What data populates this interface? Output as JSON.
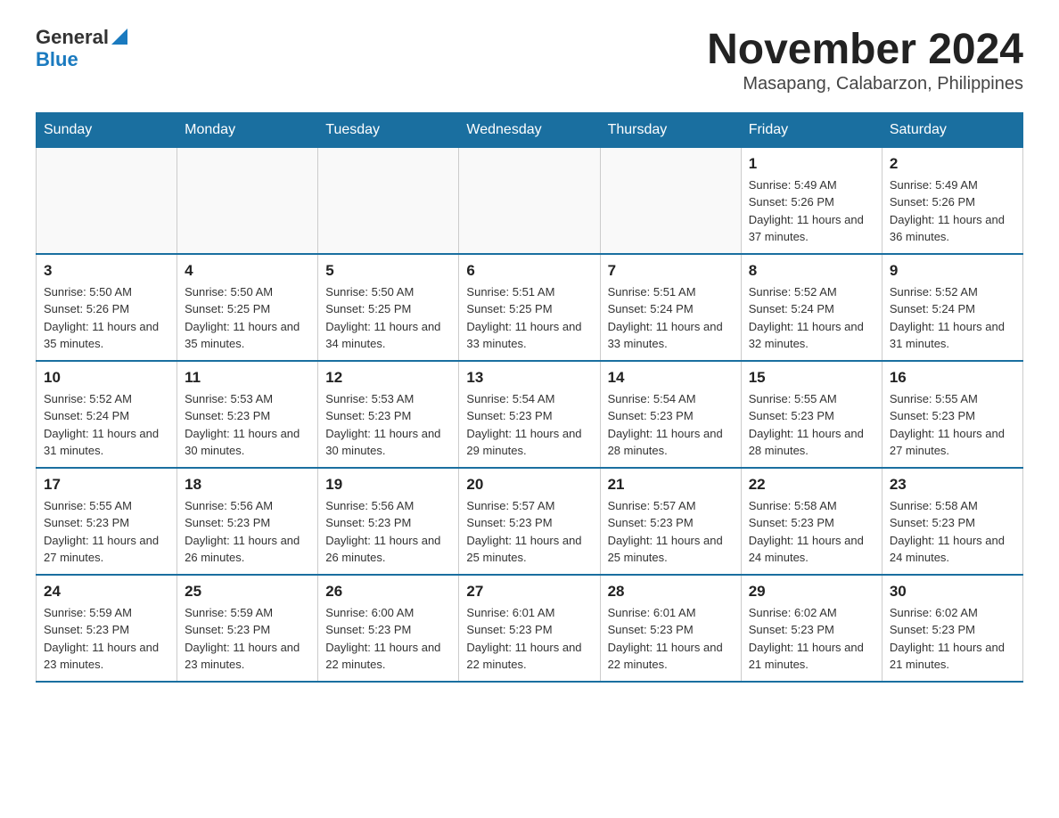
{
  "logo": {
    "general": "General",
    "blue": "Blue"
  },
  "title": "November 2024",
  "subtitle": "Masapang, Calabarzon, Philippines",
  "weekdays": [
    "Sunday",
    "Monday",
    "Tuesday",
    "Wednesday",
    "Thursday",
    "Friday",
    "Saturday"
  ],
  "weeks": [
    [
      {
        "day": "",
        "info": ""
      },
      {
        "day": "",
        "info": ""
      },
      {
        "day": "",
        "info": ""
      },
      {
        "day": "",
        "info": ""
      },
      {
        "day": "",
        "info": ""
      },
      {
        "day": "1",
        "info": "Sunrise: 5:49 AM\nSunset: 5:26 PM\nDaylight: 11 hours and 37 minutes."
      },
      {
        "day": "2",
        "info": "Sunrise: 5:49 AM\nSunset: 5:26 PM\nDaylight: 11 hours and 36 minutes."
      }
    ],
    [
      {
        "day": "3",
        "info": "Sunrise: 5:50 AM\nSunset: 5:26 PM\nDaylight: 11 hours and 35 minutes."
      },
      {
        "day": "4",
        "info": "Sunrise: 5:50 AM\nSunset: 5:25 PM\nDaylight: 11 hours and 35 minutes."
      },
      {
        "day": "5",
        "info": "Sunrise: 5:50 AM\nSunset: 5:25 PM\nDaylight: 11 hours and 34 minutes."
      },
      {
        "day": "6",
        "info": "Sunrise: 5:51 AM\nSunset: 5:25 PM\nDaylight: 11 hours and 33 minutes."
      },
      {
        "day": "7",
        "info": "Sunrise: 5:51 AM\nSunset: 5:24 PM\nDaylight: 11 hours and 33 minutes."
      },
      {
        "day": "8",
        "info": "Sunrise: 5:52 AM\nSunset: 5:24 PM\nDaylight: 11 hours and 32 minutes."
      },
      {
        "day": "9",
        "info": "Sunrise: 5:52 AM\nSunset: 5:24 PM\nDaylight: 11 hours and 31 minutes."
      }
    ],
    [
      {
        "day": "10",
        "info": "Sunrise: 5:52 AM\nSunset: 5:24 PM\nDaylight: 11 hours and 31 minutes."
      },
      {
        "day": "11",
        "info": "Sunrise: 5:53 AM\nSunset: 5:23 PM\nDaylight: 11 hours and 30 minutes."
      },
      {
        "day": "12",
        "info": "Sunrise: 5:53 AM\nSunset: 5:23 PM\nDaylight: 11 hours and 30 minutes."
      },
      {
        "day": "13",
        "info": "Sunrise: 5:54 AM\nSunset: 5:23 PM\nDaylight: 11 hours and 29 minutes."
      },
      {
        "day": "14",
        "info": "Sunrise: 5:54 AM\nSunset: 5:23 PM\nDaylight: 11 hours and 28 minutes."
      },
      {
        "day": "15",
        "info": "Sunrise: 5:55 AM\nSunset: 5:23 PM\nDaylight: 11 hours and 28 minutes."
      },
      {
        "day": "16",
        "info": "Sunrise: 5:55 AM\nSunset: 5:23 PM\nDaylight: 11 hours and 27 minutes."
      }
    ],
    [
      {
        "day": "17",
        "info": "Sunrise: 5:55 AM\nSunset: 5:23 PM\nDaylight: 11 hours and 27 minutes."
      },
      {
        "day": "18",
        "info": "Sunrise: 5:56 AM\nSunset: 5:23 PM\nDaylight: 11 hours and 26 minutes."
      },
      {
        "day": "19",
        "info": "Sunrise: 5:56 AM\nSunset: 5:23 PM\nDaylight: 11 hours and 26 minutes."
      },
      {
        "day": "20",
        "info": "Sunrise: 5:57 AM\nSunset: 5:23 PM\nDaylight: 11 hours and 25 minutes."
      },
      {
        "day": "21",
        "info": "Sunrise: 5:57 AM\nSunset: 5:23 PM\nDaylight: 11 hours and 25 minutes."
      },
      {
        "day": "22",
        "info": "Sunrise: 5:58 AM\nSunset: 5:23 PM\nDaylight: 11 hours and 24 minutes."
      },
      {
        "day": "23",
        "info": "Sunrise: 5:58 AM\nSunset: 5:23 PM\nDaylight: 11 hours and 24 minutes."
      }
    ],
    [
      {
        "day": "24",
        "info": "Sunrise: 5:59 AM\nSunset: 5:23 PM\nDaylight: 11 hours and 23 minutes."
      },
      {
        "day": "25",
        "info": "Sunrise: 5:59 AM\nSunset: 5:23 PM\nDaylight: 11 hours and 23 minutes."
      },
      {
        "day": "26",
        "info": "Sunrise: 6:00 AM\nSunset: 5:23 PM\nDaylight: 11 hours and 22 minutes."
      },
      {
        "day": "27",
        "info": "Sunrise: 6:01 AM\nSunset: 5:23 PM\nDaylight: 11 hours and 22 minutes."
      },
      {
        "day": "28",
        "info": "Sunrise: 6:01 AM\nSunset: 5:23 PM\nDaylight: 11 hours and 22 minutes."
      },
      {
        "day": "29",
        "info": "Sunrise: 6:02 AM\nSunset: 5:23 PM\nDaylight: 11 hours and 21 minutes."
      },
      {
        "day": "30",
        "info": "Sunrise: 6:02 AM\nSunset: 5:23 PM\nDaylight: 11 hours and 21 minutes."
      }
    ]
  ]
}
